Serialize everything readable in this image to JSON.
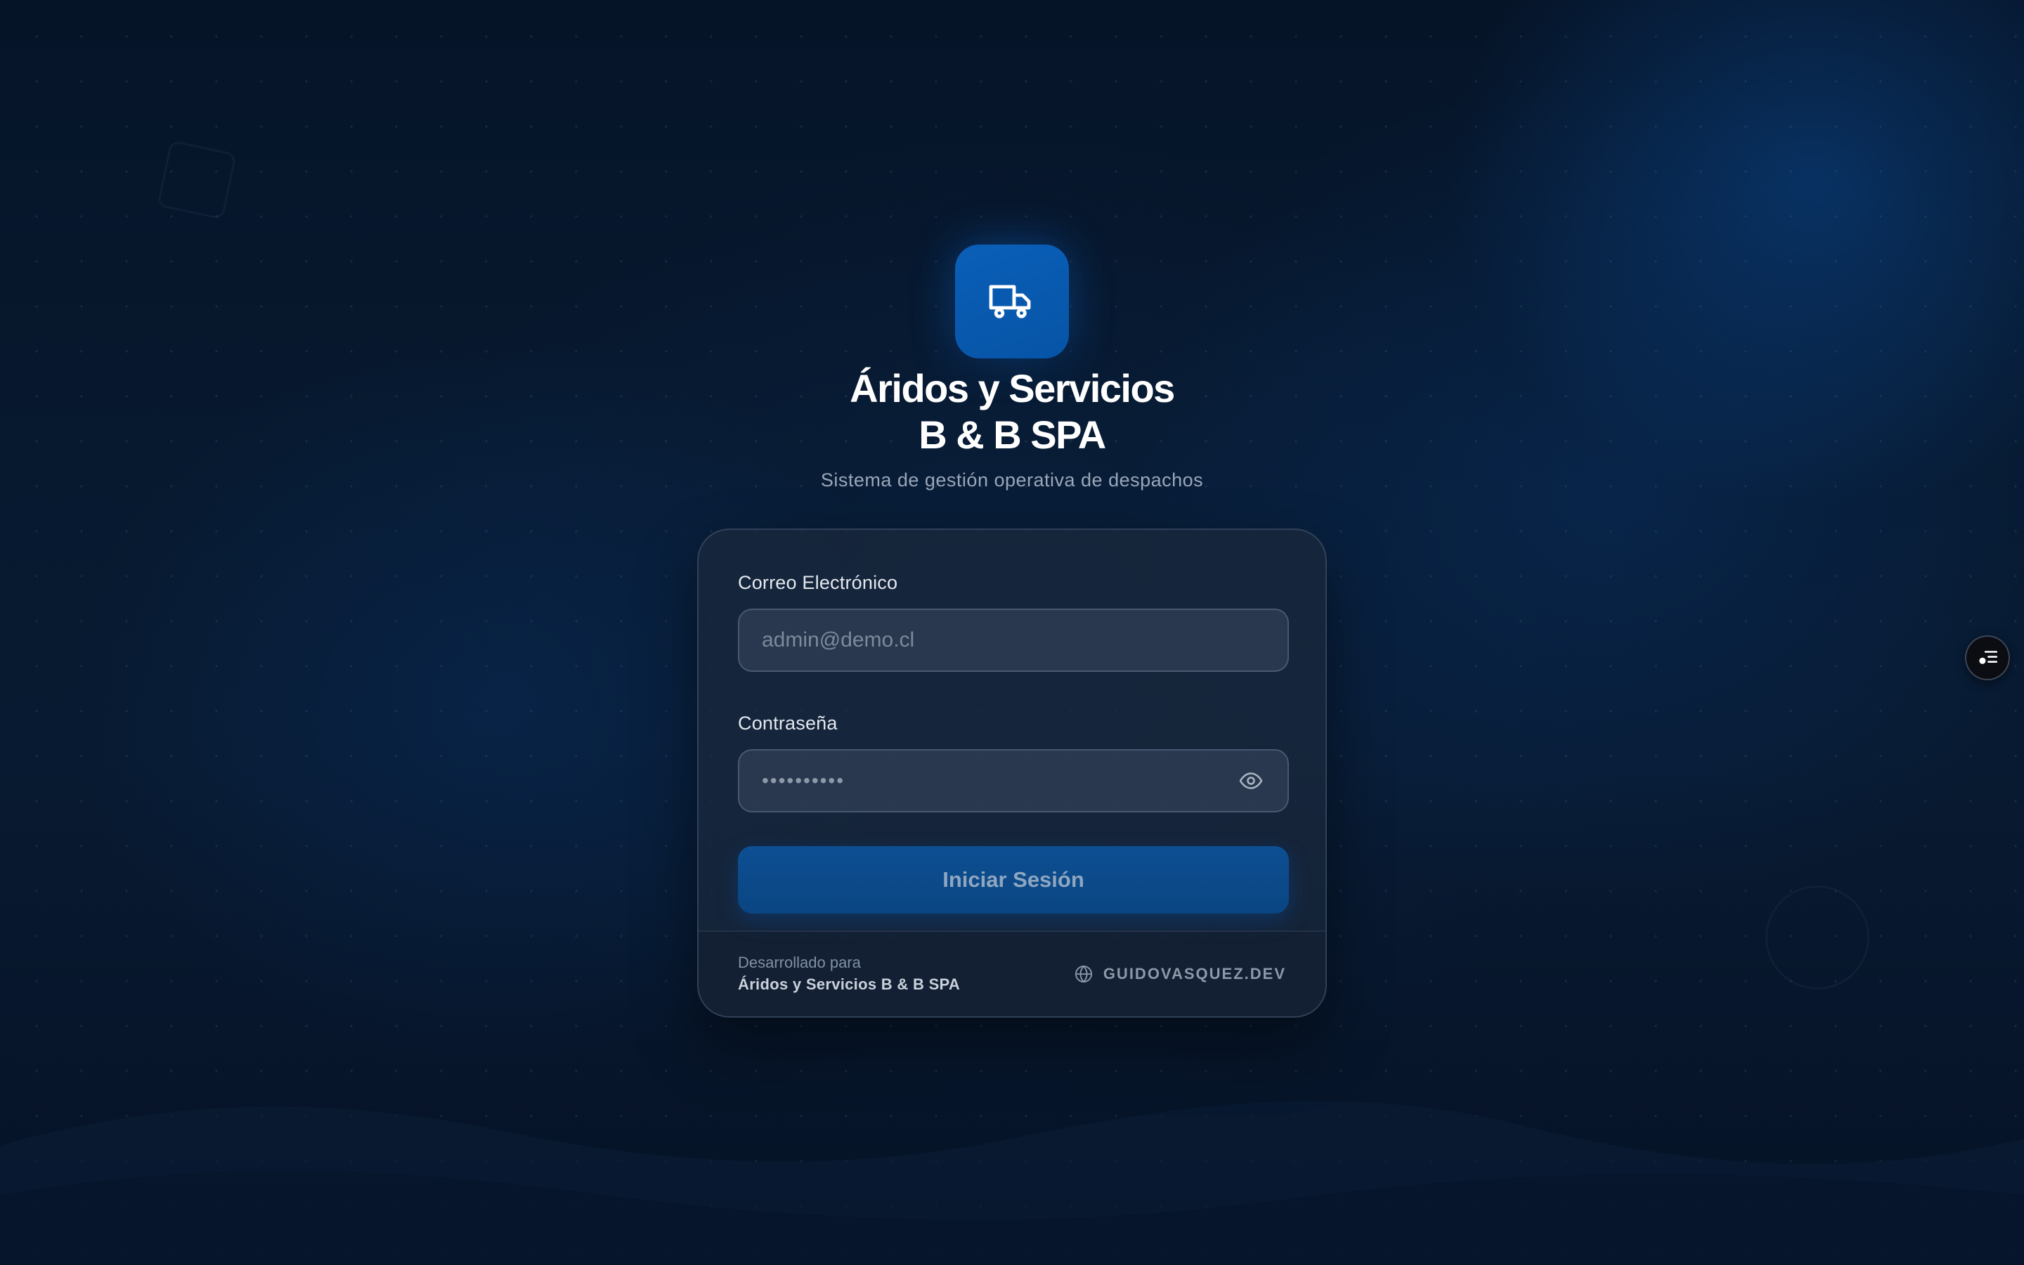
{
  "brand": {
    "logo_icon": "truck-icon",
    "title_line1": "Áridos y Servicios",
    "title_line2": "B & B SPA",
    "subtitle": "Sistema de gestión operativa de despachos"
  },
  "login_form": {
    "email_label": "Correo Electrónico",
    "email_placeholder": "admin@demo.cl",
    "password_label": "Contraseña",
    "password_mask": "••••••••••",
    "password_toggle_icon": "eye-icon",
    "submit_label": "Iniciar Sesión"
  },
  "footer": {
    "developed_for_label": "Desarrollado para",
    "company_name": "Áridos y Servicios B & B SPA",
    "website_icon": "globe-icon",
    "website_label": "GUIDOVASQUEZ.DEV"
  },
  "floating_widget": {
    "icon": "menu-list-icon"
  },
  "colors": {
    "background": "#07192f",
    "accent": "#0654a6",
    "button": "#0d4f93",
    "card": "#1a283c",
    "text_primary": "#ffffff",
    "text_muted": "#9aa7b8"
  }
}
